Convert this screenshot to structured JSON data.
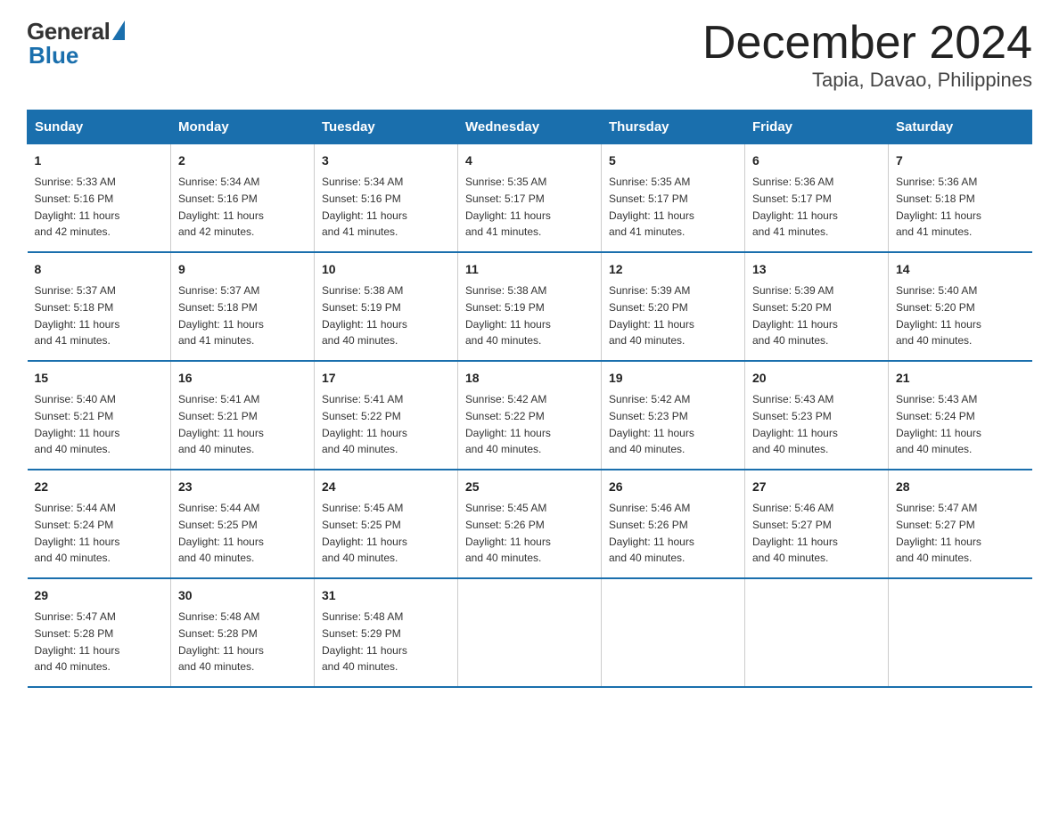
{
  "logo": {
    "general": "General",
    "blue": "Blue"
  },
  "header": {
    "month": "December 2024",
    "location": "Tapia, Davao, Philippines"
  },
  "days_of_week": [
    "Sunday",
    "Monday",
    "Tuesday",
    "Wednesday",
    "Thursday",
    "Friday",
    "Saturday"
  ],
  "weeks": [
    [
      {
        "day": "1",
        "sunrise": "5:33 AM",
        "sunset": "5:16 PM",
        "daylight": "11 hours and 42 minutes."
      },
      {
        "day": "2",
        "sunrise": "5:34 AM",
        "sunset": "5:16 PM",
        "daylight": "11 hours and 42 minutes."
      },
      {
        "day": "3",
        "sunrise": "5:34 AM",
        "sunset": "5:16 PM",
        "daylight": "11 hours and 41 minutes."
      },
      {
        "day": "4",
        "sunrise": "5:35 AM",
        "sunset": "5:17 PM",
        "daylight": "11 hours and 41 minutes."
      },
      {
        "day": "5",
        "sunrise": "5:35 AM",
        "sunset": "5:17 PM",
        "daylight": "11 hours and 41 minutes."
      },
      {
        "day": "6",
        "sunrise": "5:36 AM",
        "sunset": "5:17 PM",
        "daylight": "11 hours and 41 minutes."
      },
      {
        "day": "7",
        "sunrise": "5:36 AM",
        "sunset": "5:18 PM",
        "daylight": "11 hours and 41 minutes."
      }
    ],
    [
      {
        "day": "8",
        "sunrise": "5:37 AM",
        "sunset": "5:18 PM",
        "daylight": "11 hours and 41 minutes."
      },
      {
        "day": "9",
        "sunrise": "5:37 AM",
        "sunset": "5:18 PM",
        "daylight": "11 hours and 41 minutes."
      },
      {
        "day": "10",
        "sunrise": "5:38 AM",
        "sunset": "5:19 PM",
        "daylight": "11 hours and 40 minutes."
      },
      {
        "day": "11",
        "sunrise": "5:38 AM",
        "sunset": "5:19 PM",
        "daylight": "11 hours and 40 minutes."
      },
      {
        "day": "12",
        "sunrise": "5:39 AM",
        "sunset": "5:20 PM",
        "daylight": "11 hours and 40 minutes."
      },
      {
        "day": "13",
        "sunrise": "5:39 AM",
        "sunset": "5:20 PM",
        "daylight": "11 hours and 40 minutes."
      },
      {
        "day": "14",
        "sunrise": "5:40 AM",
        "sunset": "5:20 PM",
        "daylight": "11 hours and 40 minutes."
      }
    ],
    [
      {
        "day": "15",
        "sunrise": "5:40 AM",
        "sunset": "5:21 PM",
        "daylight": "11 hours and 40 minutes."
      },
      {
        "day": "16",
        "sunrise": "5:41 AM",
        "sunset": "5:21 PM",
        "daylight": "11 hours and 40 minutes."
      },
      {
        "day": "17",
        "sunrise": "5:41 AM",
        "sunset": "5:22 PM",
        "daylight": "11 hours and 40 minutes."
      },
      {
        "day": "18",
        "sunrise": "5:42 AM",
        "sunset": "5:22 PM",
        "daylight": "11 hours and 40 minutes."
      },
      {
        "day": "19",
        "sunrise": "5:42 AM",
        "sunset": "5:23 PM",
        "daylight": "11 hours and 40 minutes."
      },
      {
        "day": "20",
        "sunrise": "5:43 AM",
        "sunset": "5:23 PM",
        "daylight": "11 hours and 40 minutes."
      },
      {
        "day": "21",
        "sunrise": "5:43 AM",
        "sunset": "5:24 PM",
        "daylight": "11 hours and 40 minutes."
      }
    ],
    [
      {
        "day": "22",
        "sunrise": "5:44 AM",
        "sunset": "5:24 PM",
        "daylight": "11 hours and 40 minutes."
      },
      {
        "day": "23",
        "sunrise": "5:44 AM",
        "sunset": "5:25 PM",
        "daylight": "11 hours and 40 minutes."
      },
      {
        "day": "24",
        "sunrise": "5:45 AM",
        "sunset": "5:25 PM",
        "daylight": "11 hours and 40 minutes."
      },
      {
        "day": "25",
        "sunrise": "5:45 AM",
        "sunset": "5:26 PM",
        "daylight": "11 hours and 40 minutes."
      },
      {
        "day": "26",
        "sunrise": "5:46 AM",
        "sunset": "5:26 PM",
        "daylight": "11 hours and 40 minutes."
      },
      {
        "day": "27",
        "sunrise": "5:46 AM",
        "sunset": "5:27 PM",
        "daylight": "11 hours and 40 minutes."
      },
      {
        "day": "28",
        "sunrise": "5:47 AM",
        "sunset": "5:27 PM",
        "daylight": "11 hours and 40 minutes."
      }
    ],
    [
      {
        "day": "29",
        "sunrise": "5:47 AM",
        "sunset": "5:28 PM",
        "daylight": "11 hours and 40 minutes."
      },
      {
        "day": "30",
        "sunrise": "5:48 AM",
        "sunset": "5:28 PM",
        "daylight": "11 hours and 40 minutes."
      },
      {
        "day": "31",
        "sunrise": "5:48 AM",
        "sunset": "5:29 PM",
        "daylight": "11 hours and 40 minutes."
      },
      null,
      null,
      null,
      null
    ]
  ],
  "labels": {
    "sunrise": "Sunrise:",
    "sunset": "Sunset:",
    "daylight": "Daylight:"
  }
}
